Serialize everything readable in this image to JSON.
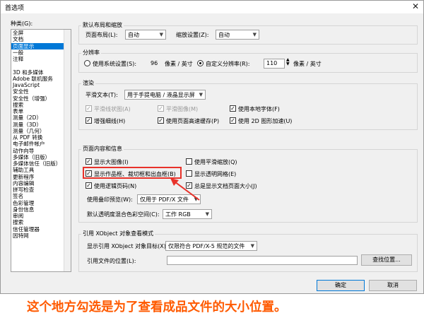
{
  "window": {
    "title": "首选项",
    "close_glyph": "✕"
  },
  "categories": {
    "label": "种类(G):",
    "items": [
      "全屏",
      "文档",
      "页面显示",
      "一般",
      "注释",
      "",
      "3D 和多媒体",
      "Adobe 联机服务",
      "JavaScript",
      "安全性",
      "安全性（增强）",
      "搜索",
      "表单",
      "测量（2D）",
      "测量（3D）",
      "测量（几何）",
      "从 PDF 转换",
      "电子邮件帐户",
      "动作向导",
      "多媒体（旧版）",
      "多媒体信任（旧版）",
      "辅助工具",
      "更新程序",
      "内容编辑",
      "拼写检查",
      "签名",
      "色彩管理",
      "身份信息",
      "审阅",
      "搜索",
      "信任管理器",
      "因特网"
    ],
    "selected_index": 2
  },
  "default_layout": {
    "legend": "默认布局和缩放",
    "page_layout_label": "页面布局(L):",
    "page_layout_value": "自动",
    "zoom_label": "缩放设置(Z):",
    "zoom_value": "自动"
  },
  "resolution": {
    "legend": "分辨率",
    "system_label": "使用系统设置(S):",
    "system_value": "96",
    "unit1": "像素 / 英寸",
    "custom_label": "自定义分辨率(R):",
    "custom_value": "110",
    "unit2": "像素 / 英寸"
  },
  "render": {
    "legend": "渲染",
    "smooth_text_label": "平滑文本(T):",
    "smooth_text_value": "用于手提电脑 / 液晶显示屏",
    "smooth_lineart": "平滑线状图(A)",
    "smooth_images": "平滑图像(M)",
    "local_fonts": "使用本地字体(F)",
    "enhance_thin": "增强细线(H)",
    "page_cache": "使用页面高速缓存(P)",
    "gpu_2d": "使用 2D 图形加速(U)"
  },
  "page_content": {
    "legend": "页面内容和信息",
    "large_images": "显示大图像(I)",
    "smooth_zoom": "使用平滑缩放(Q)",
    "art_trim_bleed": "显示作品框、裁切框和出血框(B)",
    "transparency_grid": "显示透明网格(E)",
    "logical_page_numbers": "使用逻辑页码(N)",
    "always_show_doc_size": "总是显示文档页面大小(J)",
    "overprint_label": "使用叠印预览(W):",
    "overprint_value": "仅用于 PDF/X 文件",
    "blend_label": "默认透明度混合色彩空间(C):",
    "blend_value": "工作 RGB"
  },
  "xobject": {
    "legend": "引用 XObject 对象查看模式",
    "targets_label": "显示引用 XObject 对象目标(X):",
    "targets_value": "仅限符合 PDF/X-5 规范的文件",
    "location_label": "引用文件的位置(L):",
    "browse_button": "查找位置..."
  },
  "buttons": {
    "ok": "确定",
    "cancel": "取消"
  },
  "annotation": {
    "caption": "这个地方勾选是为了查看成品文件的大小位置。",
    "color": "#ff5a00",
    "highlight_color": "#e8322a"
  }
}
